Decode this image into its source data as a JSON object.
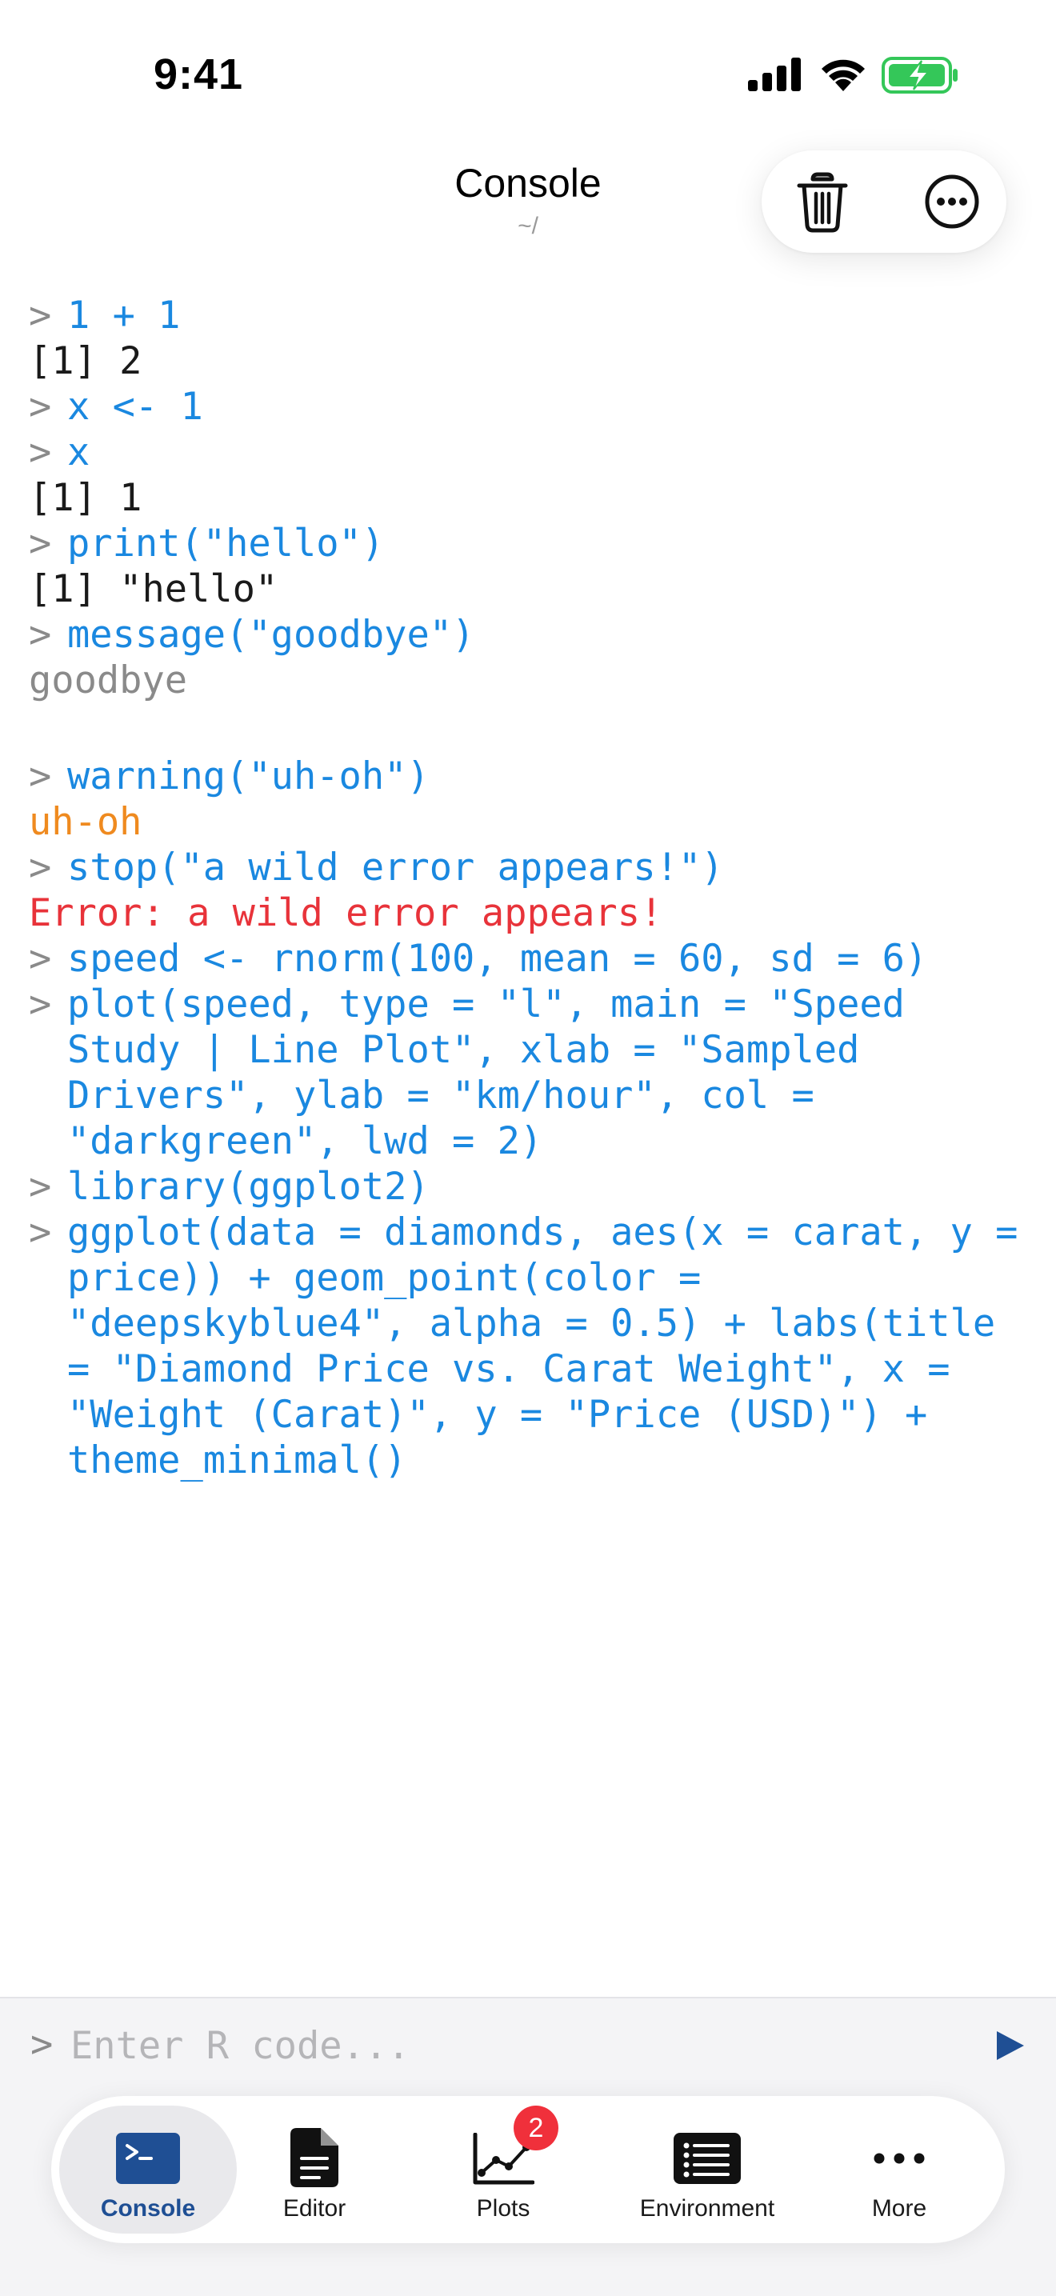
{
  "status_bar": {
    "time": "9:41"
  },
  "header": {
    "title": "Console",
    "subtitle": "~/"
  },
  "console": {
    "prompt": ">",
    "lines": [
      {
        "kind": "cmd",
        "text": "1 + 1"
      },
      {
        "kind": "out",
        "text": "[1] 2"
      },
      {
        "kind": "cmd",
        "text": "x <- 1"
      },
      {
        "kind": "cmd",
        "text": "x"
      },
      {
        "kind": "out",
        "text": "[1] 1"
      },
      {
        "kind": "cmd",
        "text": "print(\"hello\")"
      },
      {
        "kind": "out",
        "text": "[1] \"hello\""
      },
      {
        "kind": "cmd",
        "text": "message(\"goodbye\")"
      },
      {
        "kind": "msg",
        "text": "goodbye"
      },
      {
        "kind": "cmd",
        "text": "warning(\"uh-oh\")"
      },
      {
        "kind": "warn",
        "text": "uh-oh"
      },
      {
        "kind": "cmd",
        "text": "stop(\"a wild error appears!\")"
      },
      {
        "kind": "err",
        "text": "Error: a wild error appears!"
      },
      {
        "kind": "cmd",
        "text": "speed <- rnorm(100, mean = 60, sd = 6)"
      },
      {
        "kind": "cmd",
        "text": "plot(speed, type = \"l\", main = \"Speed Study | Line Plot\", xlab = \"Sampled Drivers\", ylab = \"km/hour\", col = \"darkgreen\", lwd = 2)"
      },
      {
        "kind": "cmd",
        "text": "library(ggplot2)"
      },
      {
        "kind": "cmd",
        "text": "ggplot(data = diamonds, aes(x = carat, y = price)) + geom_point(color = \"deepskyblue4\", alpha = 0.5) + labs(title = \"Diamond Price vs. Carat Weight\", x = \"Weight (Carat)\", y = \"Price (USD)\") + theme_minimal()"
      }
    ]
  },
  "input": {
    "prompt": ">",
    "placeholder": "Enter R code...",
    "value": ""
  },
  "tabs": [
    {
      "label": "Console",
      "icon": "terminal-icon",
      "active": true
    },
    {
      "label": "Editor",
      "icon": "document-icon",
      "active": false
    },
    {
      "label": "Plots",
      "icon": "line-chart-icon",
      "active": false,
      "badge": "2"
    },
    {
      "label": "Environment",
      "icon": "list-icon",
      "active": false
    },
    {
      "label": "More",
      "icon": "ellipsis-icon",
      "active": false
    }
  ],
  "colors": {
    "command": "#1a88e0",
    "output": "#1a1a1a",
    "message": "#8a8a8a",
    "warning": "#ef8a1f",
    "error": "#e8333a",
    "accent": "#1f4f94",
    "battery": "#34c759",
    "badge": "#f0303b"
  }
}
